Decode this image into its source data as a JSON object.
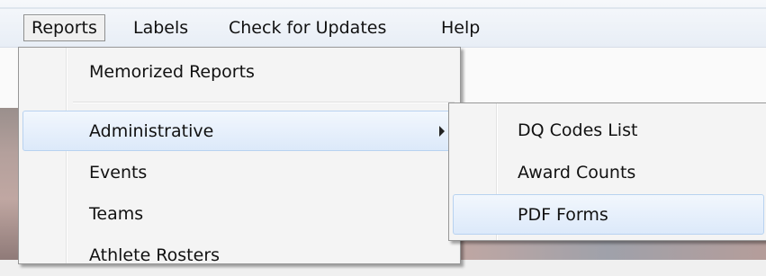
{
  "menubar": {
    "items": [
      {
        "label": "Reports"
      },
      {
        "label": "Labels"
      },
      {
        "label": "Check for Updates"
      },
      {
        "label": "Help"
      }
    ]
  },
  "reports_menu": {
    "items": [
      {
        "label": "Memorized Reports"
      },
      {
        "label": "Administrative",
        "has_submenu": true,
        "highlighted": true
      },
      {
        "label": "Events"
      },
      {
        "label": "Teams"
      },
      {
        "label": "Athlete Rosters"
      }
    ]
  },
  "administrative_submenu": {
    "items": [
      {
        "label": "DQ Codes List"
      },
      {
        "label": "Award Counts"
      },
      {
        "label": "PDF Forms",
        "highlighted": true
      }
    ]
  },
  "colors": {
    "highlight_border": "#b8d2f0",
    "highlight_fill": "#dce9fa",
    "menu_background": "#f4f4f4"
  }
}
